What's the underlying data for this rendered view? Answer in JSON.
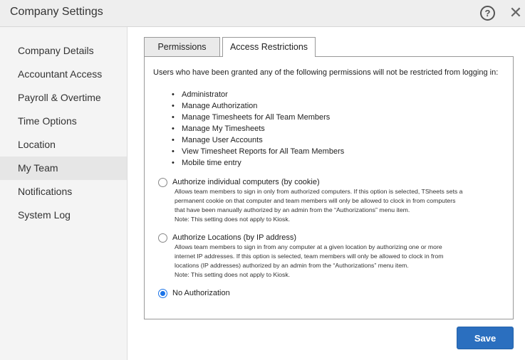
{
  "window": {
    "title": "Company Settings",
    "help_icon_glyph": "?",
    "close_icon_glyph": "✕"
  },
  "sidebar": {
    "items": [
      {
        "label": "Company Details"
      },
      {
        "label": "Accountant Access"
      },
      {
        "label": "Payroll & Overtime"
      },
      {
        "label": "Time Options"
      },
      {
        "label": "Location"
      },
      {
        "label": "My Team",
        "active": true
      },
      {
        "label": "Notifications"
      },
      {
        "label": "System Log"
      }
    ]
  },
  "tabs": [
    {
      "label": "Permissions",
      "active": false
    },
    {
      "label": "Access Restrictions",
      "active": true
    }
  ],
  "content": {
    "intro": "Users who have been granted any of the following permissions will not be restricted from logging in:",
    "permissions": [
      "Administrator",
      "Manage Authorization",
      "Manage Timesheets for All Team Members",
      "Manage My Timesheets",
      "Manage User Accounts",
      "View Timesheet Reports for All Team Members",
      "Mobile time entry"
    ],
    "options": [
      {
        "label": "Authorize individual computers (by cookie)",
        "description_lines": [
          "Allows team members to sign in only from authorized computers. If this option is selected, TSheets sets a",
          "permanent cookie on that computer and team members will only be allowed to clock in from computers",
          "that have been manually authorized by an admin from the “Authorizations” menu item.",
          "Note: This setting does not apply to Kiosk."
        ],
        "checked": false
      },
      {
        "label": "Authorize Locations (by IP address)",
        "description_lines": [
          "Allows team members to sign in from any computer at a given location by authorizing one or more",
          "internet IP addresses. If this option is selected, team members will only be allowed to clock in from",
          "locations (IP addresses) authorized by an admin from the “Authorizations” menu item.",
          "Note: This setting does not apply to Kiosk."
        ],
        "checked": false
      },
      {
        "label": "No Authorization",
        "description_lines": [],
        "checked": true
      }
    ]
  },
  "footer": {
    "save_label": "Save"
  },
  "colors": {
    "accent": "#2b6fbf",
    "radio_selected": "#1a73e8"
  }
}
